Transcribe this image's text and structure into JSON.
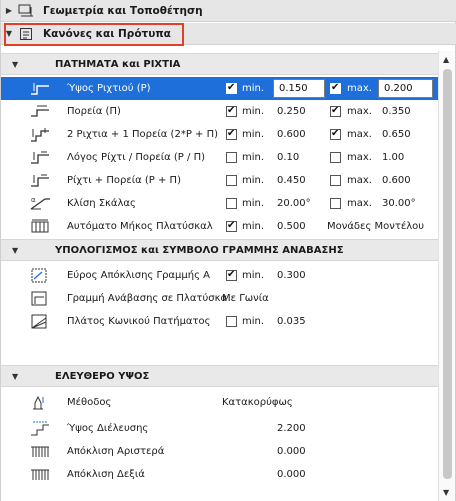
{
  "panels": {
    "geometry": {
      "title": "Γεωμετρία και Τοποθέτηση",
      "expanded": false
    },
    "rules": {
      "title": "Κανόνες και Πρότυπα",
      "expanded": true
    }
  },
  "sections": {
    "treads_risers": {
      "title": "ΠΑΤΗΜΑΤΑ και ΡΙΧΤΙΑ",
      "rows": [
        {
          "label": "Ύψος Ριχτιού (Ρ)",
          "icon": "riser-height-icon",
          "min_checked": true,
          "min_label": "min.",
          "min_value": "0.150",
          "max_checked": true,
          "max_label": "max.",
          "max_value": "0.200"
        },
        {
          "label": "Πορεία (Π)",
          "icon": "going-icon",
          "min_checked": true,
          "min_label": "min.",
          "min_value": "0.250",
          "max_checked": true,
          "max_label": "max.",
          "max_value": "0.350"
        },
        {
          "label": "2 Ριχτια + 1 Πορεία (2*Ρ + Π)",
          "icon": "rule-2r-g-icon",
          "min_checked": true,
          "min_label": "min.",
          "min_value": "0.600",
          "max_checked": true,
          "max_label": "max.",
          "max_value": "0.650"
        },
        {
          "label": "Λόγος Ρίχτι / Πορεία (Ρ / Π)",
          "icon": "ratio-icon",
          "min_checked": false,
          "min_label": "min.",
          "min_value": "0.10",
          "max_checked": false,
          "max_label": "max.",
          "max_value": "1.00"
        },
        {
          "label": "Ρίχτι + Πορεία (Ρ + Π)",
          "icon": "sum-icon",
          "min_checked": false,
          "min_label": "min.",
          "min_value": "0.450",
          "max_checked": false,
          "max_label": "max.",
          "max_value": "0.600"
        },
        {
          "label": "Κλίση Σκάλας",
          "icon": "slope-icon",
          "min_checked": false,
          "min_label": "min.",
          "min_value": "20.00°",
          "max_checked": false,
          "max_label": "max.",
          "max_value": "30.00°"
        },
        {
          "label": "Αυτόματο Μήκος Πλατύσκαλ",
          "icon": "landing-length-icon",
          "min_checked": true,
          "min_label": "min.",
          "min_value": "0.500",
          "extra": "Μονάδες Μοντέλου"
        }
      ]
    },
    "walking_line": {
      "title": "ΥΠΟΛΟΓΙΣΜΟΣ και ΣΥΜΒΟΛΟ ΓΡΑΜΜΗΣ ΑΝΑΒΑΣΗΣ",
      "rows": [
        {
          "label": "Εύρος Απόκλισης Γραμμής Α",
          "icon": "offset-range-icon",
          "min_checked": true,
          "min_label": "min.",
          "min_value": "0.300"
        },
        {
          "label": "Γραμμή Ανάβασης σε Πλατύσκαλο",
          "icon": "walking-line-landing-icon",
          "value": "Με Γωνία"
        },
        {
          "label": "Πλάτος Κωνικού Πατήματος",
          "icon": "winder-width-icon",
          "min_checked": false,
          "min_label": "min.",
          "min_value": "0.035"
        }
      ]
    },
    "headroom": {
      "title": "ΕΛΕΥΘΕΡΟ ΥΨΟΣ",
      "rows": [
        {
          "label": "Μέθοδος",
          "icon": "method-icon",
          "value": "Κατακορύφως"
        },
        {
          "label": "Ύψος Διέλευσης",
          "icon": "clearance-height-icon",
          "value": "2.200"
        },
        {
          "label": "Απόκλιση Αριστερά",
          "icon": "offset-left-icon",
          "value": "0.000"
        },
        {
          "label": "Απόκλιση Δεξιά",
          "icon": "offset-right-icon",
          "value": "0.000"
        }
      ]
    }
  },
  "colors": {
    "selection": "#1e6fd9",
    "highlight_border": "#e0402a"
  }
}
